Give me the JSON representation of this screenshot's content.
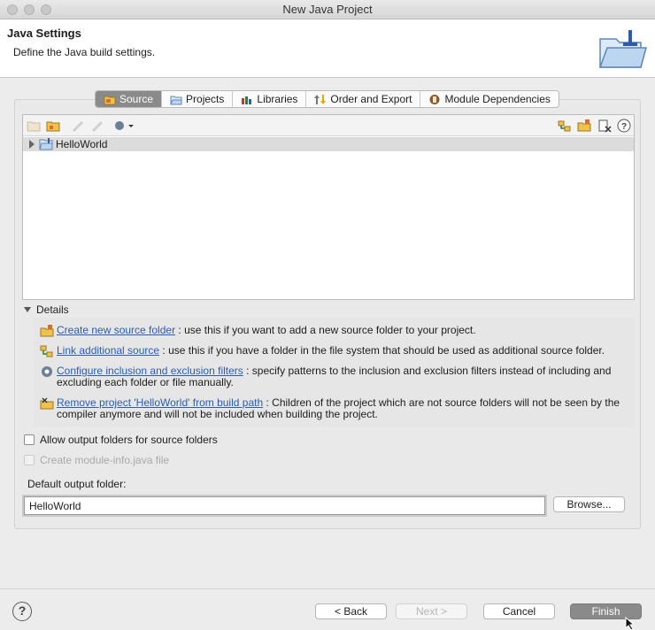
{
  "window": {
    "title": "New Java Project"
  },
  "banner": {
    "title": "Java Settings",
    "subtitle": "Define the Java build settings."
  },
  "tabs": [
    {
      "label": "Source",
      "icon": "source-folder-icon",
      "selected": true
    },
    {
      "label": "Projects",
      "icon": "projects-icon",
      "selected": false
    },
    {
      "label": "Libraries",
      "icon": "libraries-icon",
      "selected": false
    },
    {
      "label": "Order and Export",
      "icon": "order-export-icon",
      "selected": false
    },
    {
      "label": "Module Dependencies",
      "icon": "module-icon",
      "selected": false
    }
  ],
  "tree": {
    "items": [
      {
        "label": "HelloWorld",
        "expanded": false
      }
    ]
  },
  "details": {
    "label": "Details",
    "items": [
      {
        "link": "Create new source folder",
        "text": ": use this if you want to add a new source folder to your project."
      },
      {
        "link": "Link additional source",
        "text": ": use this if you have a folder in the file system that should be used as additional source folder."
      },
      {
        "link": "Configure inclusion and exclusion filters",
        "text": ": specify patterns to the inclusion and exclusion filters instead of including and excluding each folder or file manually."
      },
      {
        "link": "Remove project 'HelloWorld' from build path",
        "text": ": Children of the project which are not source folders will not be seen by the compiler anymore and will not be included when building the project."
      }
    ]
  },
  "options": {
    "allow_output": {
      "label": "Allow output folders for source folders",
      "checked": false
    },
    "module_info": {
      "label": "Create module-info.java file",
      "checked": false,
      "disabled": true
    }
  },
  "output": {
    "label": "Default output folder:",
    "value": "HelloWorld",
    "browse_label": "Browse..."
  },
  "footer": {
    "help": "?",
    "back_label": "< Back",
    "next_label": "Next >",
    "cancel_label": "Cancel",
    "finish_label": "Finish"
  },
  "colors": {
    "link": "#2a5db0",
    "selected_tab": "#8a8a8a",
    "folder": "#f0c14b"
  }
}
